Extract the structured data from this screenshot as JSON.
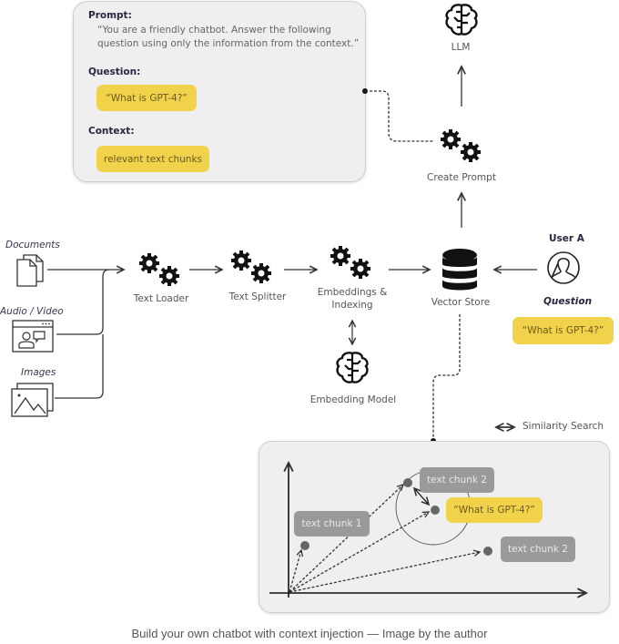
{
  "prompt_panel": {
    "prompt_heading": "Prompt:",
    "prompt_text": "“You are a friendly chatbot. Answer the following question using only the information from the context.”",
    "question_heading": "Question:",
    "question_chip": "“What is GPT-4?”",
    "context_heading": "Context:",
    "context_chip": "relevant text chunks"
  },
  "nodes": {
    "llm": {
      "label": "LLM",
      "icon": "brain-icon"
    },
    "create_prompt": {
      "label": "Create Prompt",
      "icon": "gears-icon"
    },
    "text_loader": {
      "label": "Text Loader",
      "icon": "gears-icon"
    },
    "text_splitter": {
      "label": "Text Splitter",
      "icon": "gears-icon"
    },
    "embeddings_line1": "Embeddings &",
    "embeddings_line2": "Indexing",
    "embedding_model": {
      "label": "Embedding Model",
      "icon": "brain-icon"
    },
    "vector_store": {
      "label": "Vector Store",
      "icon": "database-icon"
    }
  },
  "sources": {
    "documents": "Documents",
    "audio_video": "Audio / Video",
    "images": "Images"
  },
  "user": {
    "name": "User A",
    "question_label": "Question",
    "question_chip": "“What is GPT-4?”"
  },
  "legend": {
    "similarity_search": "Similarity Search"
  },
  "similarity_plot": {
    "chunk1": "text chunk 1",
    "chunk2_top": "text chunk 2",
    "query": "“What is GPT-4?”",
    "chunk2_right": "text chunk 2"
  },
  "colors": {
    "highlight_yellow": "#f0d34b",
    "chunk_gray": "#9a9a9a",
    "panel_bg": "#efefef"
  },
  "caption": "Build your own chatbot with context injection — Image by the author"
}
